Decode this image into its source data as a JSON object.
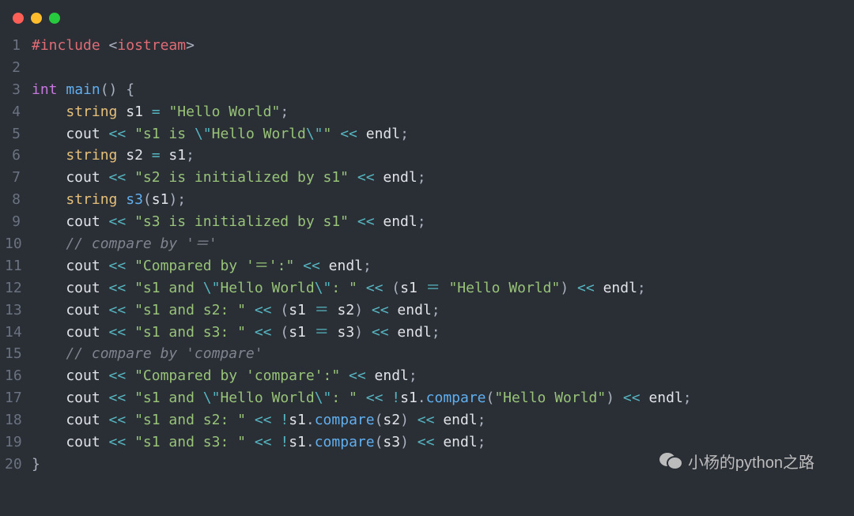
{
  "watermark": "小杨的python之路",
  "lines": [
    {
      "n": 1,
      "tokens": [
        {
          "c": "preproc",
          "t": "#include"
        },
        {
          "c": "code",
          "t": " "
        },
        {
          "c": "punct",
          "t": "<"
        },
        {
          "c": "ident",
          "t": "iostream"
        },
        {
          "c": "punct",
          "t": ">"
        }
      ]
    },
    {
      "n": 2,
      "tokens": []
    },
    {
      "n": 3,
      "tokens": [
        {
          "c": "kw",
          "t": "int"
        },
        {
          "c": "code",
          "t": " "
        },
        {
          "c": "func",
          "t": "main"
        },
        {
          "c": "punct",
          "t": "()"
        },
        {
          "c": "code",
          "t": " "
        },
        {
          "c": "punct",
          "t": "{"
        }
      ]
    },
    {
      "n": 4,
      "tokens": [
        {
          "c": "code",
          "t": "    "
        },
        {
          "c": "type",
          "t": "string"
        },
        {
          "c": "code",
          "t": " s1 "
        },
        {
          "c": "op",
          "t": "="
        },
        {
          "c": "code",
          "t": " "
        },
        {
          "c": "str",
          "t": "\"Hello World\""
        },
        {
          "c": "punct",
          "t": ";"
        }
      ]
    },
    {
      "n": 5,
      "tokens": [
        {
          "c": "code",
          "t": "    cout "
        },
        {
          "c": "op",
          "t": "<<"
        },
        {
          "c": "code",
          "t": " "
        },
        {
          "c": "str",
          "t": "\"s1 is "
        },
        {
          "c": "esc",
          "t": "\\\""
        },
        {
          "c": "str",
          "t": "Hello World"
        },
        {
          "c": "esc",
          "t": "\\\""
        },
        {
          "c": "str",
          "t": "\""
        },
        {
          "c": "code",
          "t": " "
        },
        {
          "c": "op",
          "t": "<<"
        },
        {
          "c": "code",
          "t": " endl"
        },
        {
          "c": "punct",
          "t": ";"
        }
      ]
    },
    {
      "n": 6,
      "tokens": [
        {
          "c": "code",
          "t": "    "
        },
        {
          "c": "type",
          "t": "string"
        },
        {
          "c": "code",
          "t": " s2 "
        },
        {
          "c": "op",
          "t": "="
        },
        {
          "c": "code",
          "t": " s1"
        },
        {
          "c": "punct",
          "t": ";"
        }
      ]
    },
    {
      "n": 7,
      "tokens": [
        {
          "c": "code",
          "t": "    cout "
        },
        {
          "c": "op",
          "t": "<<"
        },
        {
          "c": "code",
          "t": " "
        },
        {
          "c": "str",
          "t": "\"s2 is initialized by s1\""
        },
        {
          "c": "code",
          "t": " "
        },
        {
          "c": "op",
          "t": "<<"
        },
        {
          "c": "code",
          "t": " endl"
        },
        {
          "c": "punct",
          "t": ";"
        }
      ]
    },
    {
      "n": 8,
      "tokens": [
        {
          "c": "code",
          "t": "    "
        },
        {
          "c": "type",
          "t": "string"
        },
        {
          "c": "code",
          "t": " "
        },
        {
          "c": "func",
          "t": "s3"
        },
        {
          "c": "punct",
          "t": "("
        },
        {
          "c": "code",
          "t": "s1"
        },
        {
          "c": "punct",
          "t": ")"
        },
        {
          "c": "punct",
          "t": ";"
        }
      ]
    },
    {
      "n": 9,
      "tokens": [
        {
          "c": "code",
          "t": "    cout "
        },
        {
          "c": "op",
          "t": "<<"
        },
        {
          "c": "code",
          "t": " "
        },
        {
          "c": "str",
          "t": "\"s3 is initialized by s1\""
        },
        {
          "c": "code",
          "t": " "
        },
        {
          "c": "op",
          "t": "<<"
        },
        {
          "c": "code",
          "t": " endl"
        },
        {
          "c": "punct",
          "t": ";"
        }
      ]
    },
    {
      "n": 10,
      "tokens": [
        {
          "c": "code",
          "t": "    "
        },
        {
          "c": "comment",
          "t": "// compare by '＝'"
        }
      ]
    },
    {
      "n": 11,
      "tokens": [
        {
          "c": "code",
          "t": "    cout "
        },
        {
          "c": "op",
          "t": "<<"
        },
        {
          "c": "code",
          "t": " "
        },
        {
          "c": "str",
          "t": "\"Compared by '＝':\""
        },
        {
          "c": "code",
          "t": " "
        },
        {
          "c": "op",
          "t": "<<"
        },
        {
          "c": "code",
          "t": " endl"
        },
        {
          "c": "punct",
          "t": ";"
        }
      ]
    },
    {
      "n": 12,
      "tokens": [
        {
          "c": "code",
          "t": "    cout "
        },
        {
          "c": "op",
          "t": "<<"
        },
        {
          "c": "code",
          "t": " "
        },
        {
          "c": "str",
          "t": "\"s1 and "
        },
        {
          "c": "esc",
          "t": "\\\""
        },
        {
          "c": "str",
          "t": "Hello World"
        },
        {
          "c": "esc",
          "t": "\\\""
        },
        {
          "c": "str",
          "t": ": \""
        },
        {
          "c": "code",
          "t": " "
        },
        {
          "c": "op",
          "t": "<<"
        },
        {
          "c": "code",
          "t": " "
        },
        {
          "c": "punct",
          "t": "("
        },
        {
          "c": "code",
          "t": "s1 "
        },
        {
          "c": "op",
          "t": "＝"
        },
        {
          "c": "code",
          "t": " "
        },
        {
          "c": "str",
          "t": "\"Hello World\""
        },
        {
          "c": "punct",
          "t": ")"
        },
        {
          "c": "code",
          "t": " "
        },
        {
          "c": "op",
          "t": "<<"
        },
        {
          "c": "code",
          "t": " endl"
        },
        {
          "c": "punct",
          "t": ";"
        }
      ]
    },
    {
      "n": 13,
      "tokens": [
        {
          "c": "code",
          "t": "    cout "
        },
        {
          "c": "op",
          "t": "<<"
        },
        {
          "c": "code",
          "t": " "
        },
        {
          "c": "str",
          "t": "\"s1 and s2: \""
        },
        {
          "c": "code",
          "t": " "
        },
        {
          "c": "op",
          "t": "<<"
        },
        {
          "c": "code",
          "t": " "
        },
        {
          "c": "punct",
          "t": "("
        },
        {
          "c": "code",
          "t": "s1 "
        },
        {
          "c": "op",
          "t": "＝"
        },
        {
          "c": "code",
          "t": " s2"
        },
        {
          "c": "punct",
          "t": ")"
        },
        {
          "c": "code",
          "t": " "
        },
        {
          "c": "op",
          "t": "<<"
        },
        {
          "c": "code",
          "t": " endl"
        },
        {
          "c": "punct",
          "t": ";"
        }
      ]
    },
    {
      "n": 14,
      "tokens": [
        {
          "c": "code",
          "t": "    cout "
        },
        {
          "c": "op",
          "t": "<<"
        },
        {
          "c": "code",
          "t": " "
        },
        {
          "c": "str",
          "t": "\"s1 and s3: \""
        },
        {
          "c": "code",
          "t": " "
        },
        {
          "c": "op",
          "t": "<<"
        },
        {
          "c": "code",
          "t": " "
        },
        {
          "c": "punct",
          "t": "("
        },
        {
          "c": "code",
          "t": "s1 "
        },
        {
          "c": "op",
          "t": "＝"
        },
        {
          "c": "code",
          "t": " s3"
        },
        {
          "c": "punct",
          "t": ")"
        },
        {
          "c": "code",
          "t": " "
        },
        {
          "c": "op",
          "t": "<<"
        },
        {
          "c": "code",
          "t": " endl"
        },
        {
          "c": "punct",
          "t": ";"
        }
      ]
    },
    {
      "n": 15,
      "tokens": [
        {
          "c": "code",
          "t": "    "
        },
        {
          "c": "comment",
          "t": "// compare by 'compare'"
        }
      ]
    },
    {
      "n": 16,
      "tokens": [
        {
          "c": "code",
          "t": "    cout "
        },
        {
          "c": "op",
          "t": "<<"
        },
        {
          "c": "code",
          "t": " "
        },
        {
          "c": "str",
          "t": "\"Compared by 'compare':\""
        },
        {
          "c": "code",
          "t": " "
        },
        {
          "c": "op",
          "t": "<<"
        },
        {
          "c": "code",
          "t": " endl"
        },
        {
          "c": "punct",
          "t": ";"
        }
      ]
    },
    {
      "n": 17,
      "tokens": [
        {
          "c": "code",
          "t": "    cout "
        },
        {
          "c": "op",
          "t": "<<"
        },
        {
          "c": "code",
          "t": " "
        },
        {
          "c": "str",
          "t": "\"s1 and "
        },
        {
          "c": "esc",
          "t": "\\\""
        },
        {
          "c": "str",
          "t": "Hello World"
        },
        {
          "c": "esc",
          "t": "\\\""
        },
        {
          "c": "str",
          "t": ": \""
        },
        {
          "c": "code",
          "t": " "
        },
        {
          "c": "op",
          "t": "<<"
        },
        {
          "c": "code",
          "t": " "
        },
        {
          "c": "op",
          "t": "!"
        },
        {
          "c": "code",
          "t": "s1"
        },
        {
          "c": "punct",
          "t": "."
        },
        {
          "c": "func",
          "t": "compare"
        },
        {
          "c": "punct",
          "t": "("
        },
        {
          "c": "str",
          "t": "\"Hello World\""
        },
        {
          "c": "punct",
          "t": ")"
        },
        {
          "c": "code",
          "t": " "
        },
        {
          "c": "op",
          "t": "<<"
        },
        {
          "c": "code",
          "t": " endl"
        },
        {
          "c": "punct",
          "t": ";"
        }
      ]
    },
    {
      "n": 18,
      "tokens": [
        {
          "c": "code",
          "t": "    cout "
        },
        {
          "c": "op",
          "t": "<<"
        },
        {
          "c": "code",
          "t": " "
        },
        {
          "c": "str",
          "t": "\"s1 and s2: \""
        },
        {
          "c": "code",
          "t": " "
        },
        {
          "c": "op",
          "t": "<<"
        },
        {
          "c": "code",
          "t": " "
        },
        {
          "c": "op",
          "t": "!"
        },
        {
          "c": "code",
          "t": "s1"
        },
        {
          "c": "punct",
          "t": "."
        },
        {
          "c": "func",
          "t": "compare"
        },
        {
          "c": "punct",
          "t": "("
        },
        {
          "c": "code",
          "t": "s2"
        },
        {
          "c": "punct",
          "t": ")"
        },
        {
          "c": "code",
          "t": " "
        },
        {
          "c": "op",
          "t": "<<"
        },
        {
          "c": "code",
          "t": " endl"
        },
        {
          "c": "punct",
          "t": ";"
        }
      ]
    },
    {
      "n": 19,
      "tokens": [
        {
          "c": "code",
          "t": "    cout "
        },
        {
          "c": "op",
          "t": "<<"
        },
        {
          "c": "code",
          "t": " "
        },
        {
          "c": "str",
          "t": "\"s1 and s3: \""
        },
        {
          "c": "code",
          "t": " "
        },
        {
          "c": "op",
          "t": "<<"
        },
        {
          "c": "code",
          "t": " "
        },
        {
          "c": "op",
          "t": "!"
        },
        {
          "c": "code",
          "t": "s1"
        },
        {
          "c": "punct",
          "t": "."
        },
        {
          "c": "func",
          "t": "compare"
        },
        {
          "c": "punct",
          "t": "("
        },
        {
          "c": "code",
          "t": "s3"
        },
        {
          "c": "punct",
          "t": ")"
        },
        {
          "c": "code",
          "t": " "
        },
        {
          "c": "op",
          "t": "<<"
        },
        {
          "c": "code",
          "t": " endl"
        },
        {
          "c": "punct",
          "t": ";"
        }
      ]
    },
    {
      "n": 20,
      "tokens": [
        {
          "c": "punct",
          "t": "}"
        }
      ]
    }
  ]
}
